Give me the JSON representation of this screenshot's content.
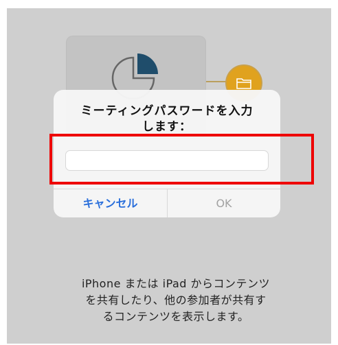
{
  "background": {
    "illustration_icons": [
      "pie-chart-icon",
      "folder-icon"
    ],
    "accent_color": "#e0a21e",
    "pie_color": "#1f4d6b"
  },
  "dialog": {
    "title": "ミーティングパスワードを入力\nします：",
    "password_input": {
      "value": "",
      "placeholder": ""
    },
    "cancel_label": "キャンセル",
    "ok_label": "OK",
    "cancel_color": "#2a6fdb",
    "ok_color": "#a2a2a2"
  },
  "highlight": {
    "color": "#ee0000"
  },
  "description": "iPhone または iPad からコンテンツ\nを共有したり、他の参加者が共有す\nるコンテンツを表示します。"
}
